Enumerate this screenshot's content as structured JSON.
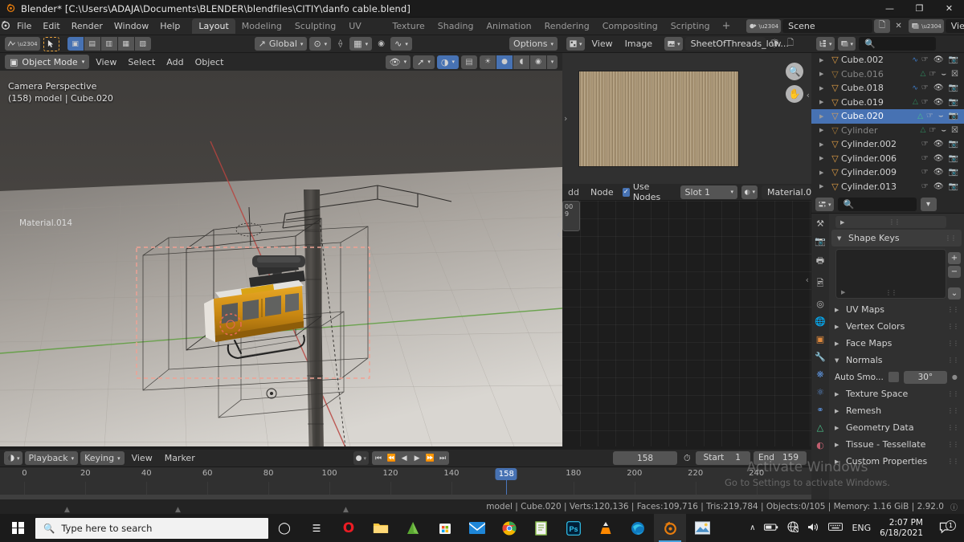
{
  "window": {
    "title": "Blender* [C:\\Users\\ADAJA\\Documents\\BLENDER\\blendfiles\\CITIY\\danfo cable.blend]",
    "app_icon": "blender-icon",
    "minimize": "—",
    "maximize": "❐",
    "close": "✕"
  },
  "topbar": {
    "menus": [
      "File",
      "Edit",
      "Render",
      "Window",
      "Help"
    ],
    "workspaces": [
      {
        "label": "Layout",
        "active": true
      },
      {
        "label": "Modeling",
        "active": false
      },
      {
        "label": "Sculpting",
        "active": false
      },
      {
        "label": "UV Editing",
        "active": false
      },
      {
        "label": "Texture Paint",
        "active": false
      },
      {
        "label": "Shading",
        "active": false
      },
      {
        "label": "Animation",
        "active": false
      },
      {
        "label": "Rendering",
        "active": false
      },
      {
        "label": "Compositing",
        "active": false
      },
      {
        "label": "Scripting",
        "active": false
      }
    ],
    "add_workspace": "+",
    "scene_name": "Scene",
    "view_layer_name": "View Layer",
    "new_icon": "duplicate-icon",
    "unlink_icon": "✕"
  },
  "viewport": {
    "toolrow": {
      "editor_type": "editor-type-icon",
      "cursor_tool": "select-box-tool",
      "select_modes": [
        "set",
        "extend",
        "subtract",
        "invert",
        "intersect"
      ],
      "transform_orientation": "Global",
      "pivot_icon": "pivot-point-icon",
      "snap_icon": "magnet-icon",
      "snap_to_icon": "snap-increment-icon",
      "proportional_icon": "proportional-editing-icon",
      "falloff_icon": "falloff-curve-icon",
      "options": "Options"
    },
    "header": {
      "mode": "Object Mode",
      "menus": [
        "View",
        "Select",
        "Add",
        "Object"
      ],
      "visibility_icon": "show-hide-icon",
      "gizmo_icon": "gizmo-icon",
      "overlays_icon": "overlays-icon",
      "xray_icon": "xray-icon",
      "shading_modes": [
        "wireframe",
        "solid",
        "material-preview",
        "rendered"
      ]
    },
    "overlay_line1": "Camera Perspective",
    "overlay_line2": "(158) model | Cube.020"
  },
  "image_editor": {
    "editor_icon": "image-editor-icon",
    "menus": [
      "View",
      "Image"
    ],
    "browse_icon": "browse-image-icon",
    "image_name": "SheetOfThreads_low...",
    "fake_user_icon": "shield-icon",
    "new_icon": "duplicate-icon",
    "zoom_icon": "zoom-icon",
    "pan_icon": "hand-icon"
  },
  "shader_editor": {
    "menus_partial": "dd",
    "node_menu": "Node",
    "use_nodes_label": "Use Nodes",
    "use_nodes_checked": true,
    "slot": "Slot 1",
    "material_icon": "material-sphere-icon",
    "material_name": "Material.0",
    "node_label": "Material.014"
  },
  "outliner": {
    "display_mode_icon": "outliner-display-icon",
    "filter_icon": "filter-icon",
    "search_icon": "search-icon",
    "search_value": "",
    "rows": [
      {
        "name": "Cube.002",
        "selected": false,
        "dim": false,
        "hidden": false,
        "data_icon": "curve-data-icon"
      },
      {
        "name": "Cube.016",
        "selected": false,
        "dim": true,
        "hidden": true,
        "data_icon": "mesh-data-icon"
      },
      {
        "name": "Cube.018",
        "selected": false,
        "dim": false,
        "hidden": false,
        "data_icon": "curve-data-icon"
      },
      {
        "name": "Cube.019",
        "selected": false,
        "dim": false,
        "hidden": false,
        "data_icon": "mesh-data-icon"
      },
      {
        "name": "Cube.020",
        "selected": true,
        "dim": false,
        "hidden": true,
        "data_icon": "mesh-data-icon"
      },
      {
        "name": "Cylinder",
        "selected": false,
        "dim": true,
        "hidden": true,
        "data_icon": "mesh-data-icon"
      },
      {
        "name": "Cylinder.002",
        "selected": false,
        "dim": false,
        "hidden": false,
        "data_icon": ""
      },
      {
        "name": "Cylinder.006",
        "selected": false,
        "dim": false,
        "hidden": false,
        "data_icon": ""
      },
      {
        "name": "Cylinder.009",
        "selected": false,
        "dim": false,
        "hidden": false,
        "data_icon": ""
      },
      {
        "name": "Cylinder.013",
        "selected": false,
        "dim": false,
        "hidden": false,
        "data_icon": ""
      }
    ]
  },
  "properties": {
    "editor_icon": "properties-editor-icon",
    "search_value": "",
    "expand_icon": "chevron-down-icon",
    "tabs": [
      "tool-icon",
      "render-icon",
      "output-icon",
      "view-layer-icon",
      "scene-icon",
      "world-icon",
      "object-icon",
      "modifier-icon",
      "particles-icon",
      "physics-icon",
      "constraint-icon",
      "data-icon",
      "material-icon"
    ],
    "panels": [
      {
        "label": "Shape Keys",
        "open": true
      },
      {
        "label": "UV Maps",
        "open": false
      },
      {
        "label": "Vertex Colors",
        "open": false
      },
      {
        "label": "Face Maps",
        "open": false
      },
      {
        "label": "Normals",
        "open": true
      },
      {
        "label": "Texture Space",
        "open": false
      },
      {
        "label": "Remesh",
        "open": false
      },
      {
        "label": "Geometry Data",
        "open": false
      },
      {
        "label": "Tissue - Tessellate",
        "open": false
      },
      {
        "label": "Custom Properties",
        "open": false
      }
    ],
    "auto_smooth_label": "Auto Smo...",
    "auto_smooth_value": "30°",
    "add_btn": "+",
    "remove_btn": "−",
    "menu_btn": "⌄"
  },
  "timeline": {
    "editor_icon": "timeline-editor-icon",
    "menus": [
      "Playback",
      "Keying",
      "View",
      "Marker"
    ],
    "record_icon": "record-icon",
    "transport": [
      "jump-start-icon",
      "prev-keyframe-icon",
      "play-reverse-icon",
      "play-icon",
      "next-keyframe-icon",
      "jump-end-icon"
    ],
    "current_frame": "158",
    "timer_icon": "stopwatch-icon",
    "start_label": "Start",
    "start_value": "1",
    "end_label": "End",
    "end_value": "159",
    "ruler_ticks": [
      0,
      20,
      40,
      60,
      80,
      100,
      120,
      140,
      180,
      200,
      220,
      240
    ],
    "playhead_frame": 158,
    "ruler_min": -8,
    "ruler_max": 258
  },
  "statusbar": {
    "text": "model | Cube.020 | Verts:120,136 | Faces:109,716 | Tris:219,784 | Objects:0/105 | Memory: 1.16 GiB | 2.92.0"
  },
  "watermark": {
    "line1": "Activate Windows",
    "line2": "Go to Settings to activate Windows."
  },
  "taskbar": {
    "start_icon": "windows-start-icon",
    "search_placeholder": "Type here to search",
    "search_icon": "search-icon",
    "apps": [
      {
        "name": "cortana-icon",
        "glyph": "○",
        "color": "#ffffff",
        "active": false
      },
      {
        "name": "task-view-icon",
        "glyph": "☰",
        "color": "#ffffff",
        "active": false
      },
      {
        "name": "opera-icon",
        "glyph": "O",
        "color": "#ec1c24",
        "active": false
      },
      {
        "name": "file-explorer-icon",
        "glyph": "▬",
        "color": "#ffc83d",
        "active": false
      },
      {
        "name": "sketchup-icon",
        "glyph": "◢",
        "color": "#5aa832",
        "active": false
      },
      {
        "name": "microsoft-store-icon",
        "glyph": "▣",
        "color": "#f2f2f2",
        "active": false
      },
      {
        "name": "mail-icon",
        "glyph": "✉",
        "color": "#2d8fe0",
        "active": false
      },
      {
        "name": "chrome-icon",
        "glyph": "◉",
        "color": "#29a34a",
        "active": false
      },
      {
        "name": "notepad-icon",
        "glyph": "✎",
        "color": "#8ec64f",
        "active": false
      },
      {
        "name": "photoshop-icon",
        "glyph": "Ps",
        "color": "#31c5f0",
        "active": false
      },
      {
        "name": "vlc-icon",
        "glyph": "▲",
        "color": "#ff8800",
        "active": false
      },
      {
        "name": "edge-icon",
        "glyph": "◔",
        "color": "#1ba1e2",
        "active": false
      },
      {
        "name": "blender-icon",
        "glyph": "◑",
        "color": "#e87d0d",
        "active": true
      },
      {
        "name": "photos-icon",
        "glyph": "⛰",
        "color": "#7cc0f5",
        "active": false
      }
    ],
    "tray": {
      "chevron": "∧",
      "battery_icon": "battery-icon",
      "network_icon": "network-icon",
      "volume_icon": "volume-icon",
      "keyboard_icon": "keyboard-icon",
      "language": "ENG",
      "time": "2:07 PM",
      "date": "6/18/2021",
      "notification_count": "1"
    }
  }
}
